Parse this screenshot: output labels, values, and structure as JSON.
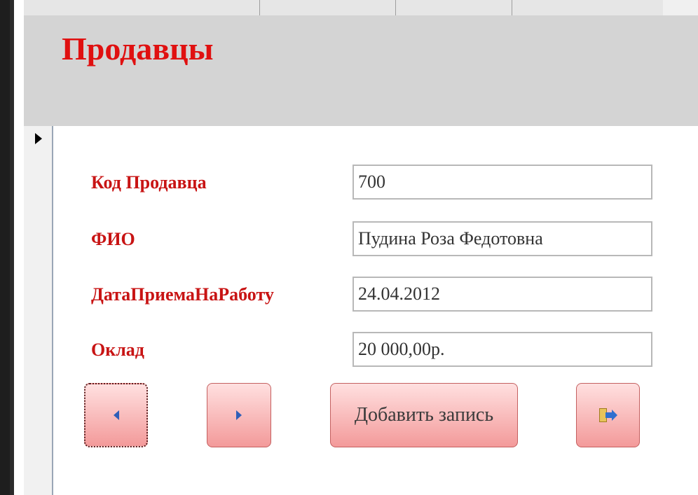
{
  "form": {
    "title": "Продавцы"
  },
  "fields": [
    {
      "label": "Код Продавца",
      "value": "700"
    },
    {
      "label": "ФИО",
      "value": "Пудина Роза Федотовна"
    },
    {
      "label": "ДатаПриемаНаРаботу",
      "value": "24.04.2012"
    },
    {
      "label": "Оклад",
      "value": "20 000,00р."
    }
  ],
  "buttons": {
    "prev_icon": "triangle-left-icon",
    "next_icon": "triangle-right-icon",
    "add_label": "Добавить запись",
    "exit_icon": "exit-door-icon"
  },
  "colors": {
    "title": "#e01010",
    "label": "#c81414",
    "header_bg": "#d4d4d4",
    "button_gradient_top": "#ffe0e0",
    "button_gradient_bottom": "#f39a9a",
    "nav_arrow": "#2f5fb8"
  }
}
